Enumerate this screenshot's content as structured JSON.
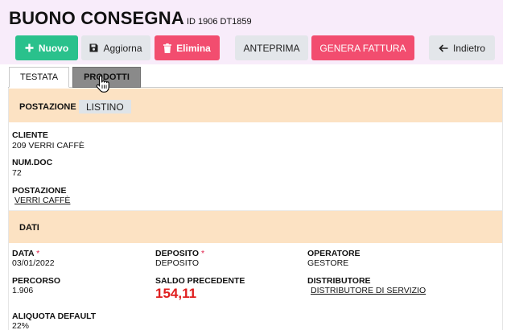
{
  "header": {
    "title": "BUONO CONSEGNA",
    "subtitle": "ID 1906 DT1859"
  },
  "toolbar": {
    "nuovo": "Nuovo",
    "aggiorna": "Aggiorna",
    "elimina": "Elimina",
    "anteprima": "ANTEPRIMA",
    "genera_fattura": "GENERA FATTURA",
    "indietro": "Indietro"
  },
  "tabs": [
    {
      "label": "TESTATA",
      "active": true
    },
    {
      "label": "PRODOTTI",
      "active": false
    }
  ],
  "postazione_section": {
    "title": "POSTAZIONE",
    "chip": "LISTINO"
  },
  "testata": {
    "cliente_label": "CLIENTE",
    "cliente_value": "209 VERRI CAFFÈ",
    "numdoc_label": "NUM.DOC",
    "numdoc_value": "72",
    "postazione_label": "POSTAZIONE",
    "postazione_value": "VERRI CAFFÈ"
  },
  "dati_section": {
    "title": "DATI"
  },
  "dati": {
    "data_label": "DATA",
    "data_value": "03/01/2022",
    "deposito_label": "DEPOSITO",
    "deposito_value": "DEPOSITO",
    "operatore_label": "OPERATORE",
    "operatore_value": "GESTORE",
    "percorso_label": "PERCORSO",
    "percorso_value": "1.906",
    "saldo_label": "SALDO PRECEDENTE",
    "saldo_value": "154,11",
    "distributore_label": "DISTRIBUTORE",
    "distributore_value": "DISTRIBUTORE DI SERVIZIO",
    "aliquota_label": "ALIQUOTA DEFAULT",
    "aliquota_value": "22%"
  },
  "colors": {
    "primary_green": "#2ac18c",
    "danger_pink": "#f24d6f",
    "neutral_gray": "#e3e6ea",
    "section_orange": "#fce2c3",
    "header_band": "#f8ecfa",
    "saldo_red": "#e01e1e"
  },
  "icons": {
    "nuovo": "plus-icon",
    "aggiorna": "save-icon",
    "elimina": "trash-icon",
    "indietro": "arrow-left-icon",
    "cursor": "hand-pointer-icon"
  }
}
